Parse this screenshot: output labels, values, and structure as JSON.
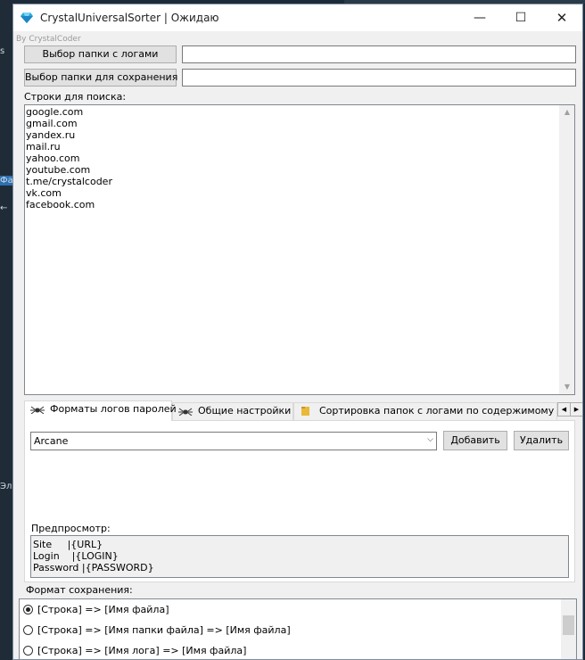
{
  "window": {
    "title": "CrystalUniversalSorter | Ожидаю",
    "byline": "By CrystalCoder",
    "controls": {
      "minimize": "—",
      "maximize": "☐",
      "close": "✕"
    }
  },
  "background": {
    "items": [
      "s",
      "Фа",
      "←",
      "Эл"
    ]
  },
  "folders": {
    "logs_button": "Выбор папки с логами",
    "logs_path": "",
    "save_button": "Выбор папки для сохранения",
    "save_path": ""
  },
  "search": {
    "label": "Строки для поиска:",
    "lines": [
      "google.com",
      "gmail.com",
      "yandex.ru",
      "mail.ru",
      "yahoo.com",
      "youtube.com",
      "t.me/crystalcoder",
      "vk.com",
      "facebook.com"
    ]
  },
  "tabs": [
    {
      "label": "Форматы логов паролей",
      "icon": "spider-icon",
      "active": true
    },
    {
      "label": "Общие настройки",
      "icon": "spider-icon",
      "active": false
    },
    {
      "label": "Сортировка папок с логами по содержимому файлов",
      "icon": "folder-icon",
      "active": false
    }
  ],
  "formats": {
    "selected": "Arcane",
    "add_button": "Добавить",
    "delete_button": "Удалить",
    "preview_label": "Предпросмотр:",
    "preview_lines": [
      "Site     |{URL}",
      "Login    |{LOGIN}",
      "Password |{PASSWORD}"
    ]
  },
  "save_format": {
    "label": "Формат сохранения:",
    "options": [
      {
        "label": "[Строка] => [Имя файла]",
        "checked": true
      },
      {
        "label": "[Строка] => [Имя папки файла] => [Имя файла]",
        "checked": false
      },
      {
        "label": "[Строка] => [Имя лога] => [Имя файла]",
        "checked": false
      }
    ]
  },
  "colors": {
    "accent_icon": "#2aa9e0",
    "folder_icon": "#e8b93a"
  }
}
